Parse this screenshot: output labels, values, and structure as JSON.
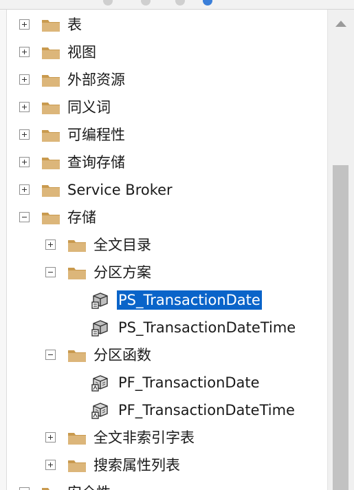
{
  "tree": {
    "items": [
      {
        "label": "表",
        "expander": "plus",
        "icon": "folder-icon"
      },
      {
        "label": "视图",
        "expander": "plus",
        "icon": "folder-icon"
      },
      {
        "label": "外部资源",
        "expander": "plus",
        "icon": "folder-icon"
      },
      {
        "label": "同义词",
        "expander": "plus",
        "icon": "folder-icon"
      },
      {
        "label": "可编程性",
        "expander": "plus",
        "icon": "folder-icon"
      },
      {
        "label": "查询存储",
        "expander": "plus",
        "icon": "folder-icon"
      },
      {
        "label": "Service Broker",
        "expander": "plus",
        "icon": "folder-icon"
      },
      {
        "label": "存储",
        "expander": "minus",
        "icon": "folder-icon"
      },
      {
        "label": "全文目录",
        "expander": "plus",
        "icon": "folder-icon"
      },
      {
        "label": "分区方案",
        "expander": "minus",
        "icon": "folder-icon"
      },
      {
        "label": "PS_TransactionDate",
        "icon": "partition-scheme-icon",
        "selected": true
      },
      {
        "label": "PS_TransactionDateTime",
        "icon": "partition-scheme-icon"
      },
      {
        "label": "分区函数",
        "expander": "minus",
        "icon": "folder-icon"
      },
      {
        "label": "PF_TransactionDate",
        "icon": "partition-function-icon"
      },
      {
        "label": "PF_TransactionDateTime",
        "icon": "partition-function-icon"
      },
      {
        "label": "全文非索引字表",
        "expander": "plus",
        "icon": "folder-icon"
      },
      {
        "label": "搜索属性列表",
        "expander": "plus",
        "icon": "folder-icon"
      },
      {
        "label": "安全性",
        "expander": "plus",
        "icon": "folder-icon"
      }
    ]
  },
  "colors": {
    "selection": "#0a64c9",
    "folder": "#dcb67a",
    "folder_dark": "#c99a4e"
  }
}
